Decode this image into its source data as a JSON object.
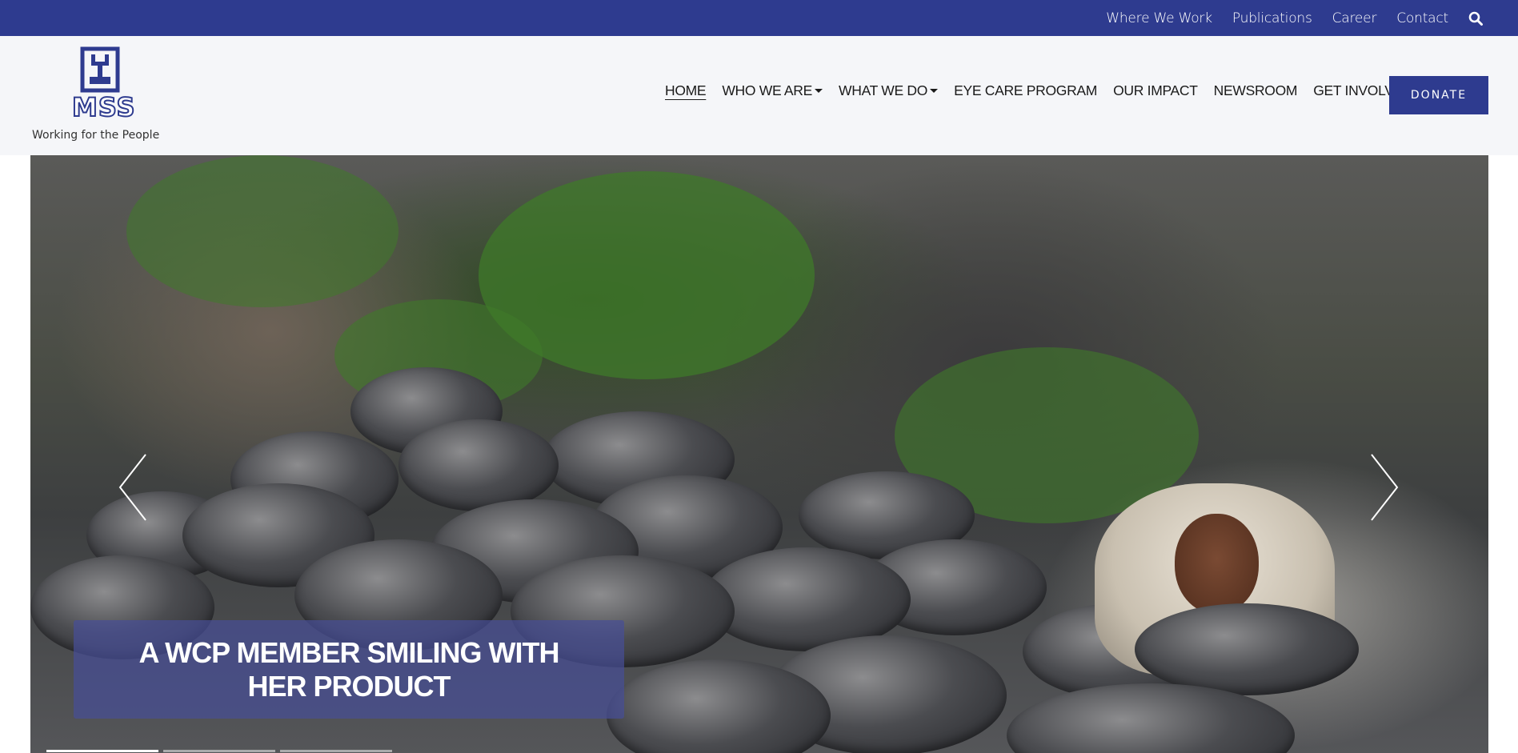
{
  "topbar": {
    "links": [
      "Where We Work",
      "Publications",
      "Career",
      "Contact"
    ],
    "search_icon": "search-icon"
  },
  "header": {
    "logo_text": "MSS",
    "logo_tagline": "Working for the People",
    "nav": [
      {
        "label": "HOME",
        "active": true,
        "dropdown": false
      },
      {
        "label": "WHO WE ARE",
        "active": false,
        "dropdown": true
      },
      {
        "label": "WHAT WE DO",
        "active": false,
        "dropdown": true
      },
      {
        "label": "EYE CARE PROGRAM",
        "active": false,
        "dropdown": false
      },
      {
        "label": "OUR IMPACT",
        "active": false,
        "dropdown": false
      },
      {
        "label": "NEWSROOM",
        "active": false,
        "dropdown": false
      },
      {
        "label": "GET INVOLVED",
        "active": false,
        "dropdown": false
      }
    ],
    "donate_label": "DONATE"
  },
  "hero": {
    "caption": "A WCP MEMBER SMILING WITH HER PRODUCT",
    "prev_icon": "chevron-left-icon",
    "next_icon": "chevron-right-icon"
  },
  "colors": {
    "brand": "#2e3b8f",
    "caption_bg": "#464e96"
  }
}
